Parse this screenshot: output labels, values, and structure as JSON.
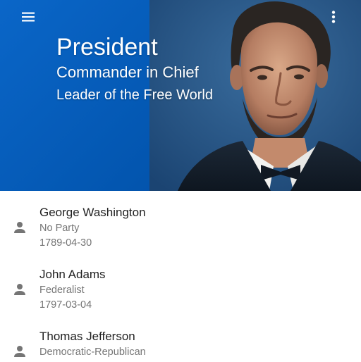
{
  "header": {
    "title": "President",
    "subtitle1": "Commander in Chief",
    "subtitle2": "Leader of the Free World",
    "background_color": "#0a66c8",
    "menu_icon": "menu-icon",
    "more_icon": "more-vert-icon"
  },
  "presidents": [
    {
      "name": "George Washington",
      "party": "No Party",
      "date": "1789-04-30",
      "icon": "person-icon"
    },
    {
      "name": "John Adams",
      "party": "Federalist",
      "date": "1797-03-04",
      "icon": "person-icon"
    },
    {
      "name": "Thomas Jefferson",
      "party": "Democratic-Republican",
      "date": "",
      "icon": "person-icon"
    }
  ]
}
